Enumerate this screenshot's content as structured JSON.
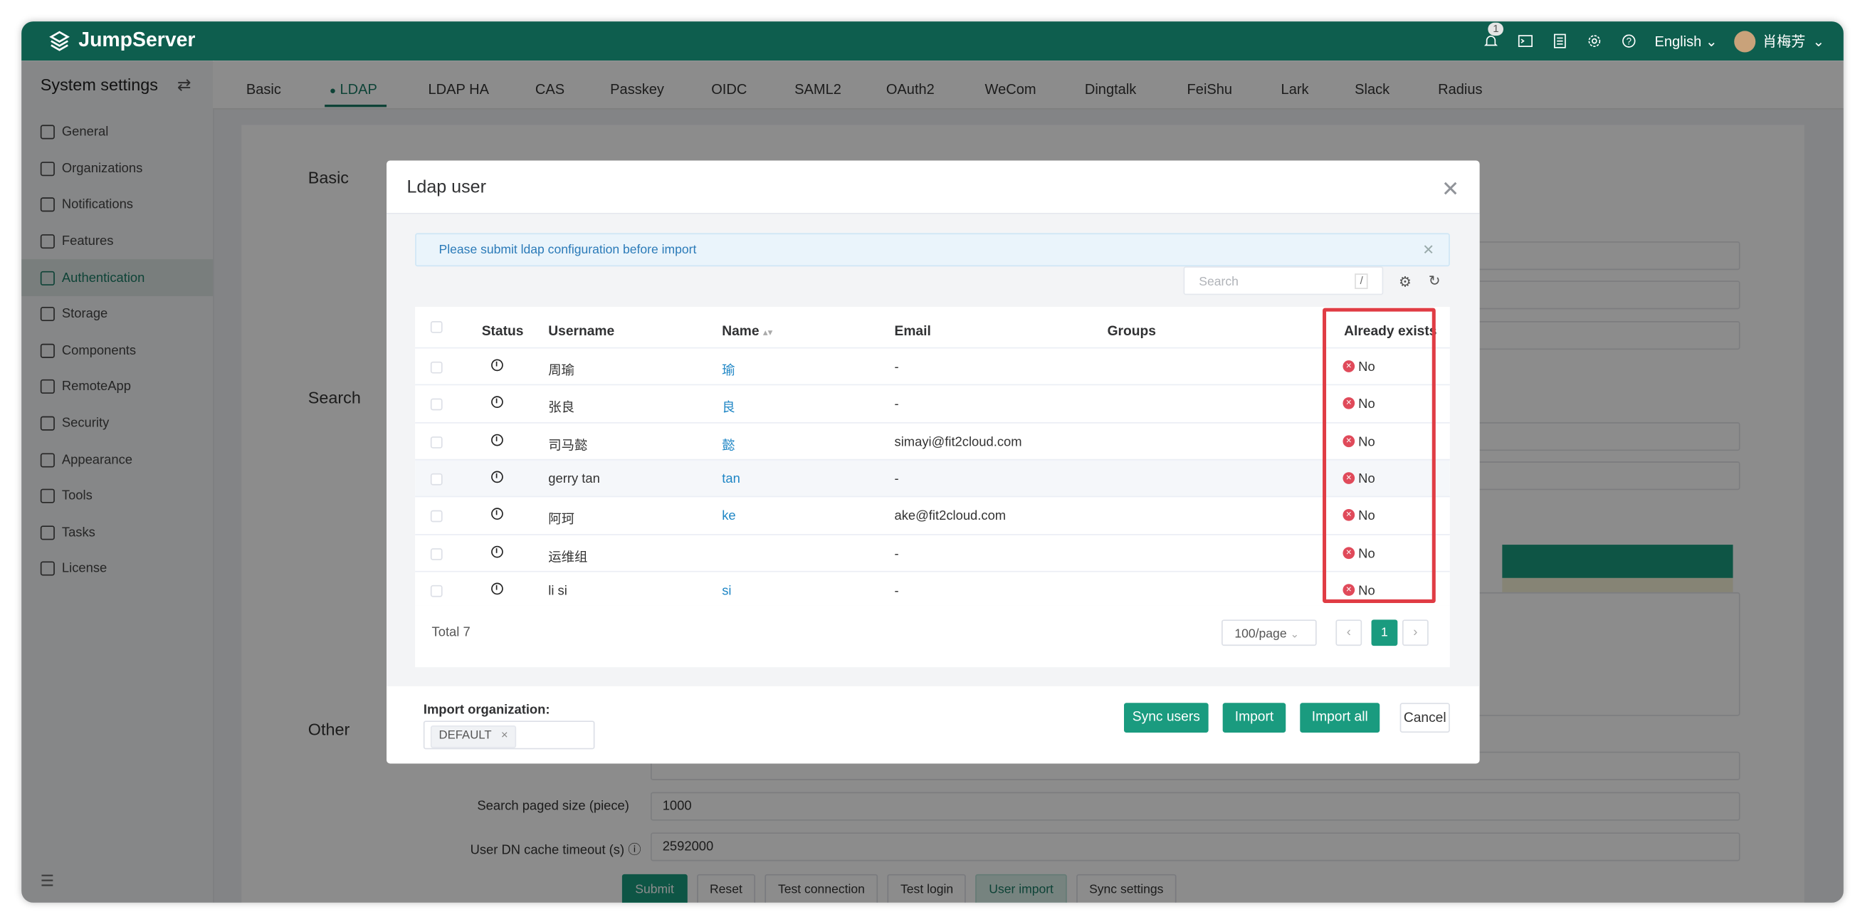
{
  "app": {
    "brand": "JumpServer"
  },
  "topbar": {
    "notification_count": "1",
    "language": "English",
    "user_name": "肖梅芳"
  },
  "sidebar": {
    "title": "System settings",
    "items": [
      {
        "label": "General"
      },
      {
        "label": "Organizations"
      },
      {
        "label": "Notifications"
      },
      {
        "label": "Features"
      },
      {
        "label": "Authentication",
        "active": true
      },
      {
        "label": "Storage"
      },
      {
        "label": "Components"
      },
      {
        "label": "RemoteApp"
      },
      {
        "label": "Security"
      },
      {
        "label": "Appearance"
      },
      {
        "label": "Tools"
      },
      {
        "label": "Tasks"
      },
      {
        "label": "License"
      }
    ]
  },
  "tabs": [
    "Basic",
    "LDAP",
    "LDAP HA",
    "CAS",
    "Passkey",
    "OIDC",
    "SAML2",
    "OAuth2",
    "WeCom",
    "Dingtalk",
    "FeiShu",
    "Lark",
    "Slack",
    "Radius"
  ],
  "active_tab": "LDAP",
  "page": {
    "breadcrumb": "Authentication",
    "sections": {
      "basic": "Basic",
      "search": "Search",
      "other": "Other"
    },
    "fields": [
      {
        "label": "Search paged size (piece)",
        "value": "1000"
      },
      {
        "label": "User DN cache timeout (s)",
        "value": "2592000"
      }
    ],
    "buttons": {
      "submit": "Submit",
      "reset": "Reset",
      "test_connection": "Test connection",
      "test_login": "Test login",
      "user_import": "User import",
      "sync_settings": "Sync settings"
    }
  },
  "modal": {
    "title": "Ldap user",
    "alert": "Please submit ldap configuration before import",
    "search_placeholder": "Search",
    "search_shortcut": "/",
    "columns": [
      "Status",
      "Username",
      "Name",
      "Email",
      "Groups",
      "Already exists"
    ],
    "rows": [
      {
        "username": "周瑜",
        "name": "瑜",
        "email": "-",
        "groups": "",
        "exists": "No"
      },
      {
        "username": "张良",
        "name": "良",
        "email": "-",
        "groups": "",
        "exists": "No"
      },
      {
        "username": "司马懿",
        "name": "懿",
        "email": "simayi@fit2cloud.com",
        "groups": "",
        "exists": "No"
      },
      {
        "username": "gerry tan",
        "name": "tan",
        "email": "-",
        "groups": "",
        "exists": "No"
      },
      {
        "username": "阿珂",
        "name": "ke",
        "email": "ake@fit2cloud.com",
        "groups": "",
        "exists": "No"
      },
      {
        "username": "运维组",
        "name": "",
        "email": "-",
        "groups": "",
        "exists": "No"
      },
      {
        "username": "li si",
        "name": "si",
        "email": "-",
        "groups": "",
        "exists": "No"
      }
    ],
    "total": "Total 7",
    "page_size": "100/page",
    "current_page": "1",
    "import_org_label": "Import organization:",
    "import_org_tag": "DEFAULT",
    "footer_buttons": {
      "sync_users": "Sync users",
      "import": "Import",
      "import_all": "Import all",
      "cancel": "Cancel"
    }
  },
  "colors": {
    "brand": "#0e5e4e",
    "primary": "#1a9b7f",
    "highlight_box": "#e03c44",
    "error_icon": "#e04a5a"
  }
}
